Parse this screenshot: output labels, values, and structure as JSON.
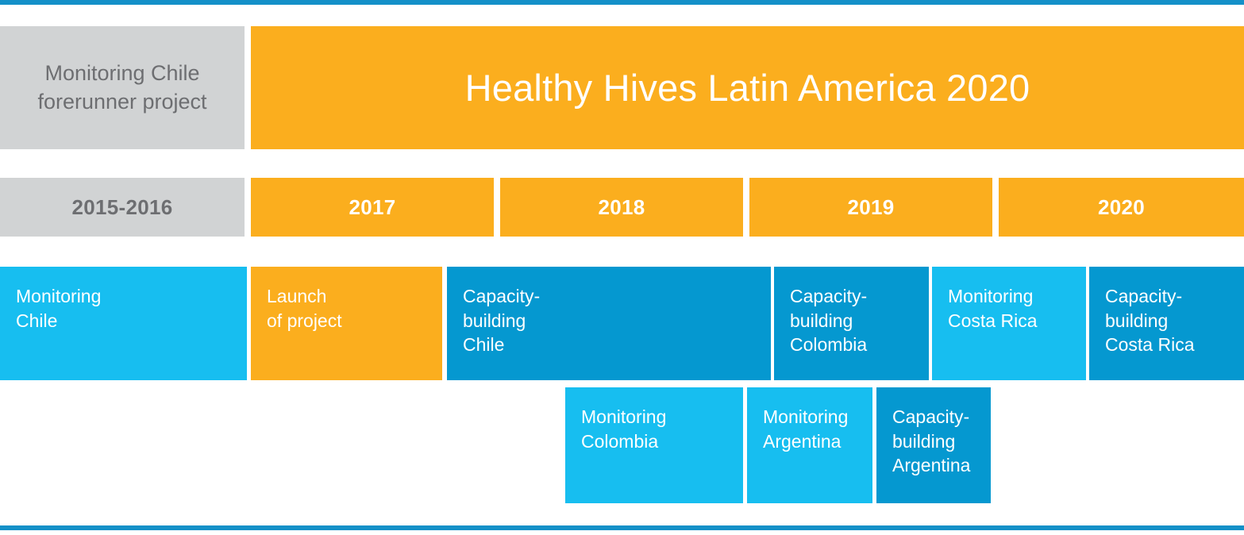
{
  "document": {
    "kind": "project-timeline-diagram",
    "top_rule_color": "#1490C8",
    "bottom_rule_color": "#1490C8"
  },
  "palette": {
    "gray": "#D1D3D4",
    "gray_text": "#6D6E71",
    "orange": "#FBAE1E",
    "light_blue": "#17BEF0",
    "dark_blue": "#0598D0",
    "rule_blue": "#1490C8",
    "white": "#FFFFFF"
  },
  "header": {
    "forerunner": {
      "label": "Monitoring Chile\nforerunner project",
      "color": "#D1D3D4"
    },
    "title": {
      "label": "Healthy Hives Latin America 2020",
      "color": "#FBAE1E"
    }
  },
  "years": [
    {
      "label": "2015-2016",
      "style": "gray"
    },
    {
      "label": "2017",
      "style": "orange"
    },
    {
      "label": "2018",
      "style": "orange"
    },
    {
      "label": "2019",
      "style": "orange"
    },
    {
      "label": "2020",
      "style": "orange"
    }
  ],
  "activities_row1": [
    {
      "label": "Monitoring\nChile",
      "style": "lightblue"
    },
    {
      "label": "Launch\nof project",
      "style": "orange"
    },
    {
      "label": "Capacity-\nbuilding\nChile",
      "style": "darkblue"
    },
    {
      "label": "Capacity-\nbuilding\nColombia",
      "style": "darkblue"
    },
    {
      "label": "Monitoring\nCosta Rica",
      "style": "lightblue"
    },
    {
      "label": "Capacity-\nbuilding\nCosta Rica",
      "style": "darkblue"
    }
  ],
  "activities_row2": [
    {
      "label": "Monitoring\nColombia",
      "style": "lightblue"
    },
    {
      "label": "Monitoring\nArgentina",
      "style": "lightblue"
    },
    {
      "label": "Capacity-\nbuilding\nArgentina",
      "style": "darkblue"
    }
  ]
}
